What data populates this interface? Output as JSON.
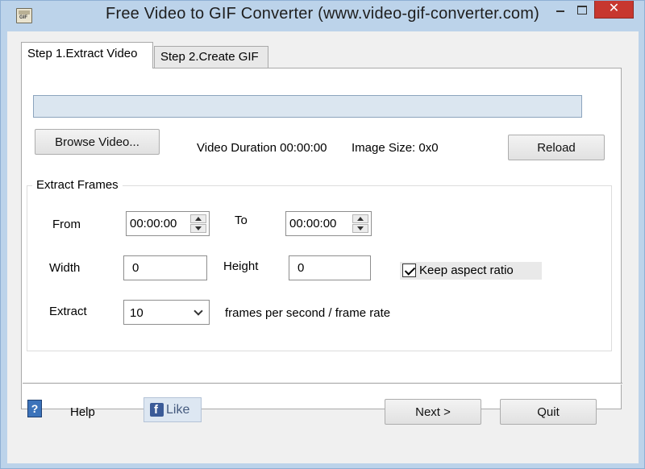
{
  "window": {
    "title": "Free Video to GIF Converter (www.video-gif-converter.com)",
    "app_icon_text": "GIF",
    "close_glyph": "✕"
  },
  "tabs": [
    {
      "label": "Step 1.Extract Video",
      "active": true
    },
    {
      "label": "Step 2.Create GIF",
      "active": false
    }
  ],
  "extract": {
    "path_value": "",
    "browse_label": "Browse Video...",
    "duration_text": "Video Duration 00:00:00",
    "image_size_text": "Image Size: 0x0",
    "reload_label": "Reload",
    "frames": {
      "group_label": "Extract Frames",
      "from_label": "From",
      "from_value": "00:00:00",
      "to_label": "To",
      "to_value": "00:00:00",
      "width_label": "Width",
      "width_value": "0",
      "height_label": "Height",
      "height_value": "0",
      "keep_aspect_label": "Keep aspect ratio",
      "keep_aspect_checked": true,
      "extract_label": "Extract",
      "fps_value": "10",
      "fps_suffix": "frames per second / frame rate"
    }
  },
  "footer": {
    "help_glyph": "?",
    "help_label": "Help",
    "like_label": "Like",
    "fb_glyph": "f",
    "next_label": "Next >",
    "quit_label": "Quit"
  },
  "colors": {
    "window_frame": "#bcd3ea",
    "close_button": "#c7372f",
    "path_field": "#dbe6f0",
    "facebook": "#3b5b98"
  }
}
